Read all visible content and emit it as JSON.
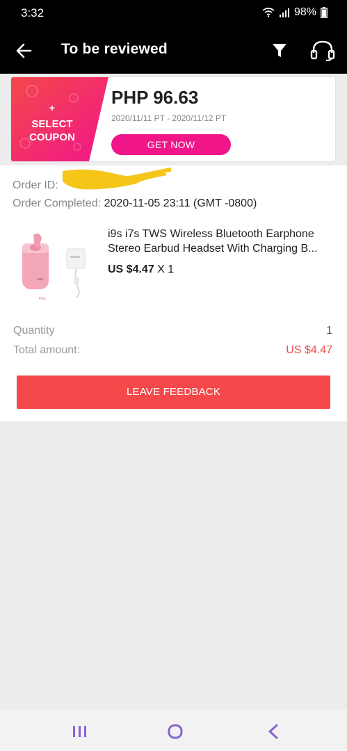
{
  "status_bar": {
    "time": "3:32",
    "battery": "98%"
  },
  "app_bar": {
    "title": "To be reviewed",
    "icons": [
      "back-arrow-icon",
      "filter-icon",
      "headset-icon"
    ]
  },
  "coupon": {
    "plus": "+",
    "label_line1": "SELECT",
    "label_line2": "COUPON",
    "amount": "PHP 96.63",
    "dates": "2020/11/11 PT - 2020/11/12 PT",
    "button_label": "GET NOW",
    "accent_color": "#f0168a",
    "gradient_colors": [
      "#f5484a",
      "#f0168a"
    ]
  },
  "order": {
    "id_label": "Order ID:",
    "id_value": "",
    "completed_label": "Order Completed:",
    "completed_value": "2020-11-05 23:11 (GMT -0800)",
    "product": {
      "title_line1": "i9s i7s TWS Wireless Bluetooth Earphone",
      "title_line2": "Stereo Earbud Headset With Charging B...",
      "price": "US $4.47",
      "quantity_suffix": "X 1",
      "image_caption": "Pink"
    },
    "quantity_label": "Quantity",
    "quantity_value": "1",
    "total_label": "Total amount:",
    "total_value": "US $4.47",
    "feedback_button": "LEAVE FEEDBACK",
    "feedback_color": "#f5484a"
  },
  "nav_bar": {
    "icons": [
      "recents-icon",
      "home-icon",
      "back-icon"
    ],
    "icon_color": "#8a63d2"
  }
}
